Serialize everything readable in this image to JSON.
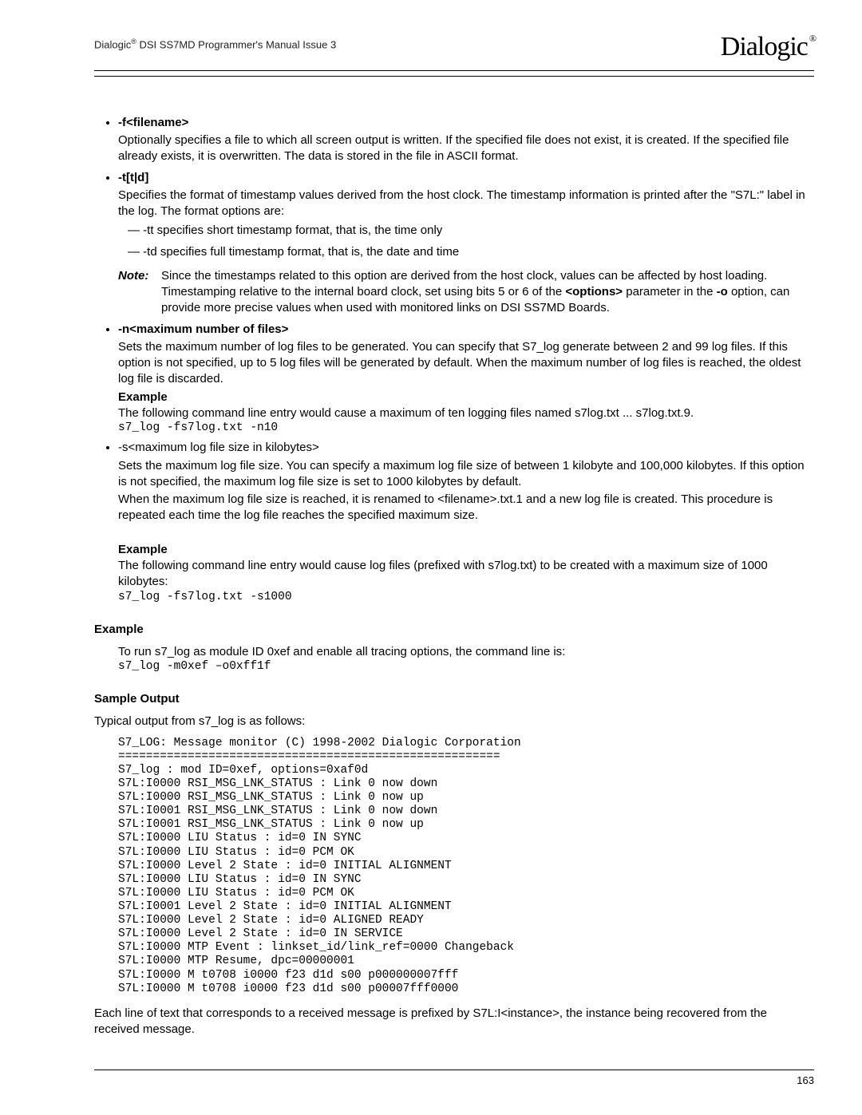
{
  "header": {
    "title_prefix": "Dialogic",
    "title_suffix": " DSI SS7MD Programmer's Manual  Issue 3",
    "brand": "Dialogic"
  },
  "options": [
    {
      "head": "-f<filename>",
      "body": "Optionally specifies a file to which all screen output is written. If the specified file does not exist, it is created. If the specified file already exists, it is overwritten. The data is stored in the file in ASCII format."
    },
    {
      "head": "-t[t|d]",
      "body": "Specifies the format of timestamp values derived from the host clock. The timestamp information is printed after the \"S7L:\" label in the log. The format options are:",
      "dashes": [
        "-tt specifies short timestamp format, that is, the time only",
        "-td specifies full timestamp format, that is, the date and time"
      ],
      "note": {
        "label": "Note:",
        "text_a": "Since the timestamps related to this option are derived from the host clock, values can be affected by host loading. Timestamping relative to the internal board clock, set using bits 5 or 6 of the ",
        "bold1": "<options>",
        "text_b": " parameter in the ",
        "bold2": "-o",
        "text_c": " option, can provide more precise values when used with monitored links on DSI SS7MD Boards."
      }
    },
    {
      "head": "-n<maximum number of files>",
      "body": "Sets the maximum number of log files to be generated. You can specify that S7_log generate between 2 and 99 log files. If this option is not specified, up to 5 log files will be generated by default. When the maximum number of log files is reached, the oldest log file is discarded.",
      "example_label": "Example",
      "example_text": "The following command line entry would cause a maximum of ten logging files named s7log.txt ... s7log.txt.9.",
      "example_code": "s7_log -fs7log.txt -n10"
    },
    {
      "head_plain": "-s<maximum log file size in kilobytes>",
      "body": "Sets the maximum log file size. You can specify a maximum log file size of between 1 kilobyte and 100,000 kilobytes. If this option is not specified, the maximum log file size is set to 1000 kilobytes by default.",
      "body2": "When the maximum log file size is reached, it is renamed to <filename>.txt.1 and a new log file is created. This procedure is repeated each time the log file reaches the specified maximum size.",
      "example_label": "Example",
      "example_text": "The following command line entry would cause log files (prefixed with s7log.txt) to be created with a maximum size of 1000 kilobytes:",
      "example_code": "s7_log -fs7log.txt -s1000"
    }
  ],
  "example_section": {
    "heading": "Example",
    "intro": "To run s7_log as module ID 0xef and enable all tracing options, the command line is:",
    "code": "s7_log -m0xef –o0xff1f"
  },
  "sample_output": {
    "heading": "Sample Output",
    "intro": "Typical output from s7_log is as follows:",
    "lines": "S7_LOG: Message monitor (C) 1998-2002 Dialogic Corporation\n=======================================================\nS7_log : mod ID=0xef, options=0xaf0d\nS7L:I0000 RSI_MSG_LNK_STATUS : Link 0 now down\nS7L:I0000 RSI_MSG_LNK_STATUS : Link 0 now up\nS7L:I0001 RSI_MSG_LNK_STATUS : Link 0 now down\nS7L:I0001 RSI_MSG_LNK_STATUS : Link 0 now up\nS7L:I0000 LIU Status : id=0 IN SYNC\nS7L:I0000 LIU Status : id=0 PCM OK\nS7L:I0000 Level 2 State : id=0 INITIAL ALIGNMENT\nS7L:I0000 LIU Status : id=0 IN SYNC\nS7L:I0000 LIU Status : id=0 PCM OK\nS7L:I0001 Level 2 State : id=0 INITIAL ALIGNMENT\nS7L:I0000 Level 2 State : id=0 ALIGNED READY\nS7L:I0000 Level 2 State : id=0 IN SERVICE\nS7L:I0000 MTP Event : linkset_id/link_ref=0000 Changeback\nS7L:I0000 MTP Resume, dpc=00000001\nS7L:I0000 M t0708 i0000 f23 d1d s00 p000000007fff\nS7L:I0000 M t0708 i0000 f23 d1d s00 p00007fff0000"
  },
  "closing": "Each line of text that corresponds to a received message is prefixed by S7L:I<instance>, the instance being recovered from the received message.",
  "page_number": "163"
}
